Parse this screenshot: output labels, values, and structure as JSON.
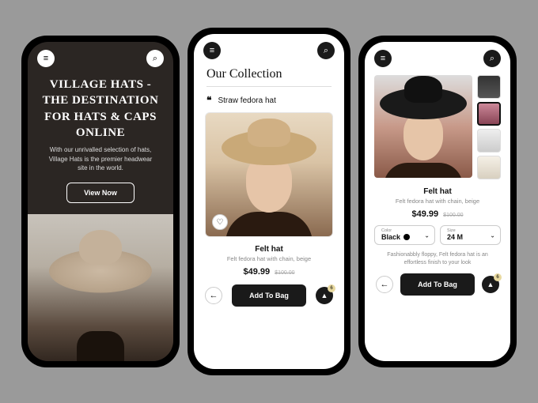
{
  "screen1": {
    "title": "VILLAGE HATS - THE DESTINATION FOR HATS & CAPS ONLINE",
    "subtitle": "With our unrivalled selection of hats, Village Hats is the premier headwear site in the world.",
    "cta": "View Now"
  },
  "screen2": {
    "heading": "Our Collection",
    "breadcrumb": "Straw fedora hat",
    "product": {
      "name": "Felt hat",
      "desc": "Felt fedora hat with chain, beige",
      "price": "$49.99",
      "old_price": "$100.00"
    },
    "add_label": "Add To Bag",
    "bag_count": "6"
  },
  "screen3": {
    "product": {
      "name": "Felt hat",
      "desc": "Felt fedora hat with chain, beige",
      "price": "$49.99",
      "old_price": "$100.00"
    },
    "color": {
      "label": "Color",
      "value": "Black"
    },
    "size": {
      "label": "Size",
      "value": "24 M"
    },
    "blurb": "Fashionabbly floppy, Felt fedora hat is an effortless finish to your look",
    "add_label": "Add To Bag",
    "bag_count": "6"
  }
}
